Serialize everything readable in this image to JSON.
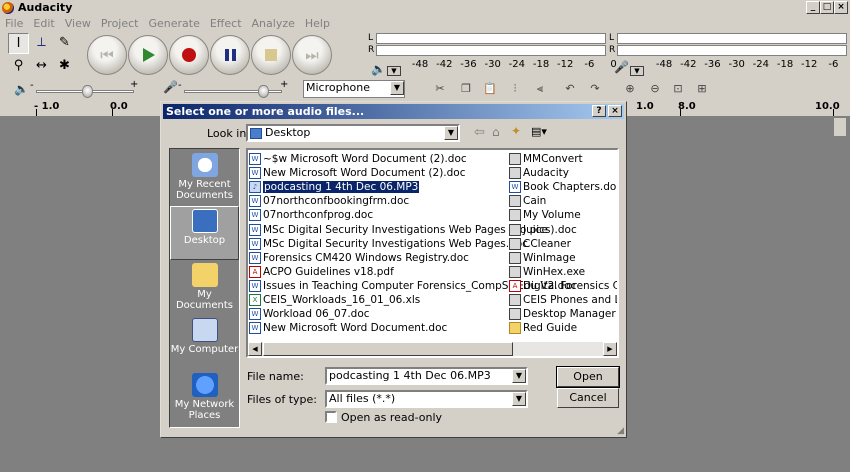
{
  "window": {
    "title": "Audacity",
    "caption_buttons": [
      "_",
      "□",
      "×"
    ]
  },
  "menu": [
    "File",
    "Edit",
    "View",
    "Project",
    "Generate",
    "Effect",
    "Analyze",
    "Help"
  ],
  "tools": {
    "selection": "I",
    "envelope": "⟂",
    "draw": "✎",
    "zoom": "⚲",
    "timeshift": "↔",
    "multi": "✱"
  },
  "meters": {
    "left_label": "L",
    "right_label": "R",
    "ticks": [
      "-48",
      "-42",
      "-36",
      "-30",
      "-24",
      "-18",
      "-12",
      "-6",
      "0"
    ]
  },
  "mixer": {
    "input_source": "Microphone"
  },
  "timeline": {
    "labels": [
      "- 1.0",
      "0.0",
      "1.0",
      "8.0",
      "10.0"
    ]
  },
  "dialog": {
    "title": "Select one or more audio files...",
    "help_button": "?",
    "close_button": "×",
    "look_in_label": "Look in:",
    "look_in_value": "Desktop",
    "places": [
      "My Recent Documents",
      "Desktop",
      "My Documents",
      "My Computer",
      "My Network Places"
    ],
    "files_left": [
      {
        "name": "~$w Microsoft Word Document (2).doc",
        "icon": "word-doc"
      },
      {
        "name": "New Microsoft Word Document (2).doc",
        "icon": "word-doc"
      },
      {
        "name": "podcasting 1 4th Dec 06.MP3",
        "icon": "audio-file"
      },
      {
        "name": "07northconfbookingfrm.doc",
        "icon": "word-doc"
      },
      {
        "name": "07northconfprog.doc",
        "icon": "word-doc"
      },
      {
        "name": "MSc Digital Security Investigations Web Pages (no pics).doc",
        "icon": "word-doc"
      },
      {
        "name": "MSc Digital Security Investigations Web Pages.doc",
        "icon": "word-doc"
      },
      {
        "name": "Forensics CM420 Windows Registry.doc",
        "icon": "word-doc"
      },
      {
        "name": "ACPO Guidelines v18.pdf",
        "icon": "pdf"
      },
      {
        "name": "Issues in Teaching Computer Forensics_CompSciEdu V2.doc",
        "icon": "word-doc"
      },
      {
        "name": "CEIS_Workloads_16_01_06.xls",
        "icon": "excel"
      },
      {
        "name": "Workload 06_07.doc",
        "icon": "word-doc"
      },
      {
        "name": "New Microsoft Word Document.doc",
        "icon": "word-doc"
      }
    ],
    "files_right": [
      {
        "name": "MMConvert",
        "icon": "app"
      },
      {
        "name": "Audacity",
        "icon": "app"
      },
      {
        "name": "Book Chapters.doc",
        "icon": "word-doc"
      },
      {
        "name": "Cain",
        "icon": "app"
      },
      {
        "name": "My Volume",
        "icon": "app"
      },
      {
        "name": "Juice",
        "icon": "app"
      },
      {
        "name": "CCleaner",
        "icon": "app"
      },
      {
        "name": "WinImage",
        "icon": "app"
      },
      {
        "name": "WinHex.exe",
        "icon": "app"
      },
      {
        "name": "Digital Forensics Conf.pd",
        "icon": "pdf"
      },
      {
        "name": "CEIS Phones and Locatio",
        "icon": "app"
      },
      {
        "name": "Desktop Manager",
        "icon": "app"
      },
      {
        "name": "Red Guide",
        "icon": "folder"
      }
    ],
    "selected_file": "podcasting 1 4th Dec 06.MP3",
    "file_name_label": "File name:",
    "file_name_value": "podcasting 1 4th Dec 06.MP3",
    "file_type_label": "Files of type:",
    "file_type_value": "All files (*.*)",
    "readonly_label": "Open as read-only",
    "readonly_checked": false,
    "open_button": "Open",
    "cancel_button": "Cancel"
  }
}
